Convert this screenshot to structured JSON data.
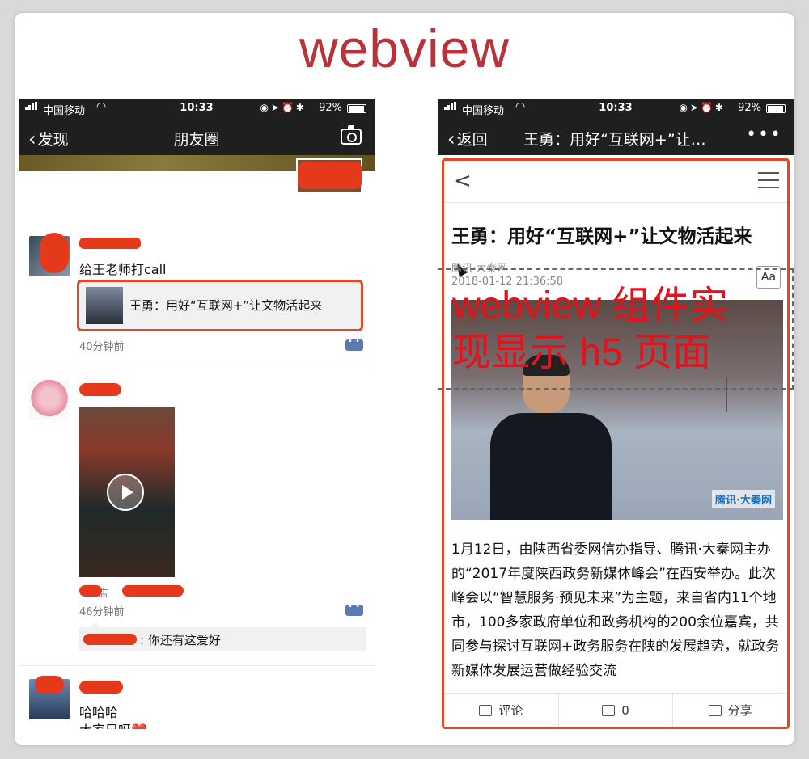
{
  "headline": "webview",
  "status_left": {
    "carrier": "中国移动",
    "time": "10:33",
    "battery": "92%"
  },
  "status_right": {
    "carrier": "中国移动",
    "time": "10:33",
    "battery": "92%"
  },
  "moments": {
    "back_label": "发现",
    "title": "朋友圈",
    "posts": [
      {
        "text": "给王老师打call",
        "link_title": "王勇：用好“互联网+”让文物活起来",
        "time": "40分钟前"
      },
      {
        "time": "46分钟前",
        "location": "· 王 店",
        "reply": ": 你还有这爱好"
      },
      {
        "text_line1": "哈哈哈",
        "text_line2": "大家早呀❤️~"
      }
    ]
  },
  "webview": {
    "back_label": "返回",
    "nav_title": "王勇：用好“互联网+”让…",
    "more": "•••",
    "article_title": "王勇：用好“互联网+”让文物活起来",
    "source": "腾讯·大秦网",
    "pub_time": "2018-01-12 21:36:58",
    "aa_label": "Aa",
    "watermark": "腾讯·大秦网",
    "overlay_line1": "webview 组件实",
    "overlay_line2": "现显示 h5 页面",
    "body": "1月12日，由陕西省委网信办指导、腾讯·大秦网主办的“2017年度陕西政务新媒体峰会”在西安举办。此次峰会以“智慧服务·预见未来”为主题，来自省内11个地市，100多家政府单位和政务机构的200余位嘉宾，共同参与探讨互联网+政务服务在陕的发展趋势，就政务新媒体发展运营做经验交流",
    "bottom": {
      "comment_label": "评论",
      "count": "0",
      "share_label": "分享"
    }
  },
  "colors": {
    "headline": "#b8323a",
    "highlight_border": "#e14a24",
    "overlay_text": "#e8101a",
    "link_blue": "#5b7ab3"
  }
}
